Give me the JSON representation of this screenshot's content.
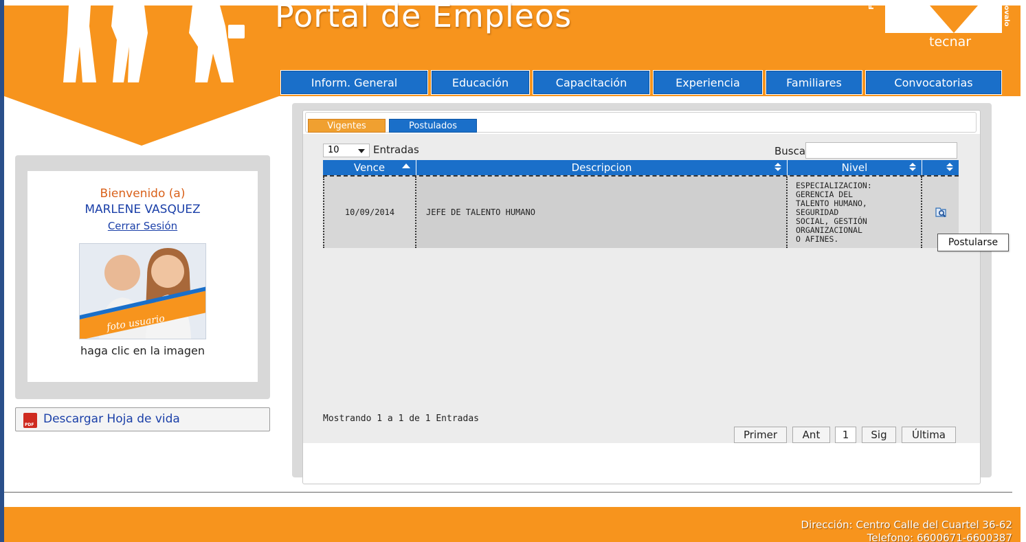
{
  "header": {
    "title": "Portal de Empleos",
    "logo_text": "tecnar",
    "logo_side_left": "Fund",
    "logo_side_right": "ovalo"
  },
  "nav": [
    {
      "label": "Inform. General"
    },
    {
      "label": "Educación"
    },
    {
      "label": "Capacitación"
    },
    {
      "label": "Experiencia"
    },
    {
      "label": "Familiares"
    },
    {
      "label": "Convocatorias"
    }
  ],
  "user": {
    "welcome": "Bienvenido (a)",
    "name": "MARLENE VASQUEZ",
    "logout": "Cerrar Sesión",
    "photo_label": "foto usuario",
    "photo_caption": "haga clic en la imagen",
    "download_label": "Descargar Hoja de vida",
    "pdf_label": "PDF"
  },
  "tabs": {
    "vigentes": "Vigentes",
    "postulados": "Postulados"
  },
  "table_controls": {
    "page_size": "10",
    "entries_label": "Entradas",
    "search_label": "Buscar",
    "search_value": ""
  },
  "table": {
    "columns": [
      "Vence",
      "Descripcion",
      "Nivel",
      ""
    ],
    "rows": [
      {
        "vence": "10/09/2014",
        "descripcion": "JEFE DE TALENTO HUMANO",
        "nivel": "ESPECIALIZACION:\nGERENCIA DEL\nTALENTO HUMANO,\nSEGURIDAD\nSOCIAL, GESTIÓN\nORGANIZACIONAL\nO AFINES."
      }
    ]
  },
  "tooltip": "Postularse",
  "pagination": {
    "info": "Mostrando 1 a 1 de 1 Entradas",
    "first": "Primer",
    "prev": "Ant",
    "current": "1",
    "next": "Sig",
    "last": "Última"
  },
  "footer": {
    "address": "Dirección: Centro Calle del Cuartel 36-62",
    "phone": "Telefono: 6600671-6600387"
  },
  "colors": {
    "orange": "#f7941d",
    "blue": "#1a6fc9",
    "tab_active": "#f0a030"
  }
}
